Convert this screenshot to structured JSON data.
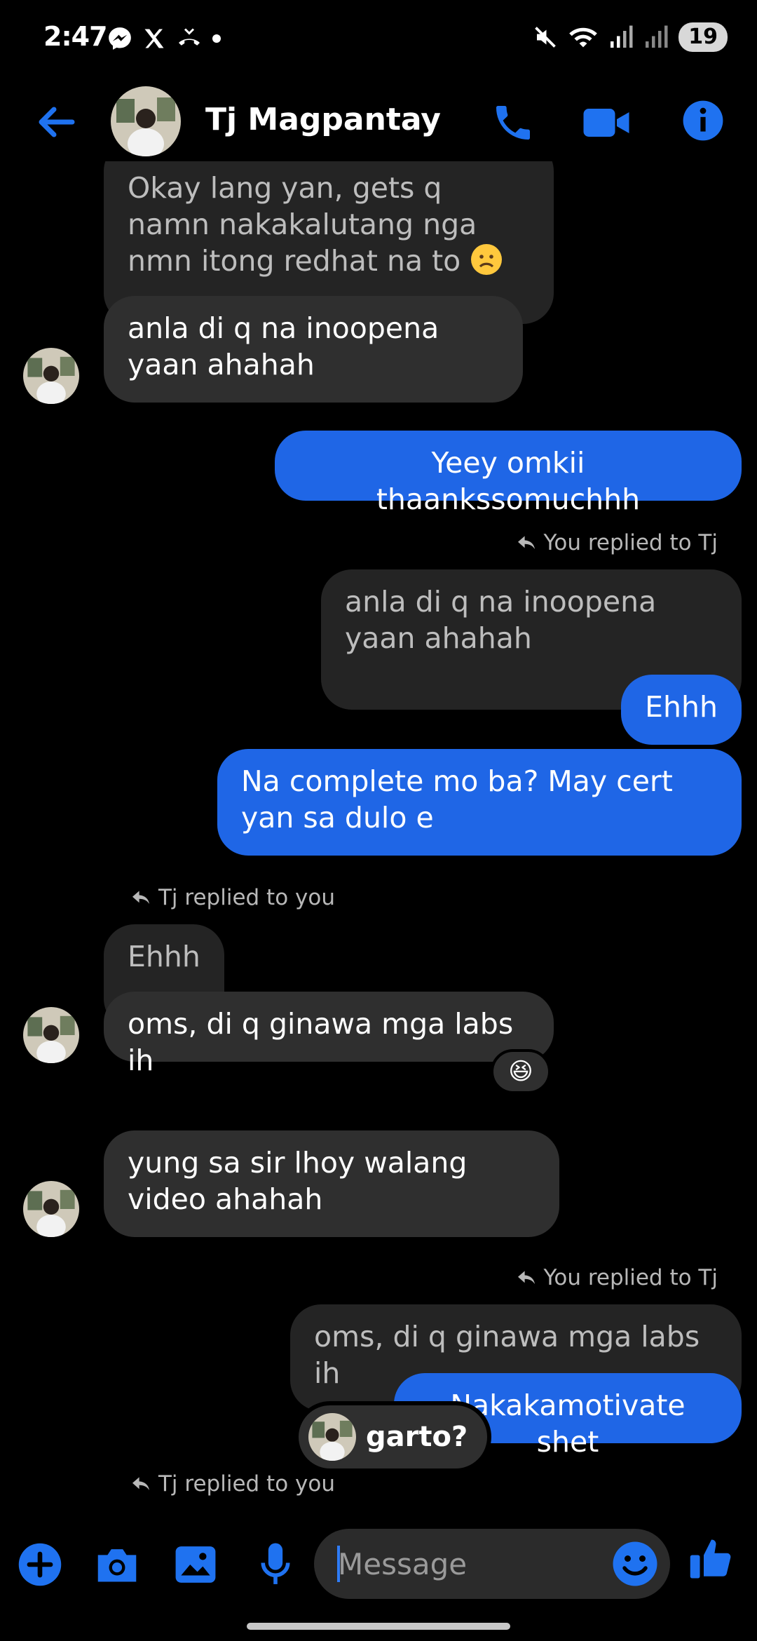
{
  "status_bar": {
    "time": "2:47",
    "battery": "19"
  },
  "header": {
    "contact_name": "Tj Magpantay"
  },
  "messages": {
    "m1_quote_text": "Okay lang yan, gets q namn nakakalutang nga nmn itong redhat na to",
    "m2_text": "anla di q na inoopena yaan ahahah",
    "m3_text": "Yeey omkii thaankssomuchhh",
    "m4_reply_meta": "You replied to Tj",
    "m4_quote_text": "anla di q na inoopena yaan ahahah",
    "m4_text": "Ehhh",
    "m5_text": "Na complete mo ba? May cert yan sa dulo e",
    "m6_reply_meta": "Tj replied to you",
    "m6_quote_text": "Ehhh",
    "m6_text": "oms, di q ginawa mga labs ih",
    "m6_reaction": "😆",
    "m7_text": "yung sa sir lhoy walang video ahahah",
    "m8_reply_meta": "You replied to Tj",
    "m8_quote_text": "oms, di q ginawa mga labs ih",
    "m8_text": "Nakakamotivate shet",
    "typing_preview": "garto?",
    "m9_reply_meta": "Tj replied to you"
  },
  "composer": {
    "placeholder": "Message"
  },
  "colors": {
    "accent": "#1f66e6",
    "received_bubble": "#2f2f2f",
    "background": "#000000"
  }
}
